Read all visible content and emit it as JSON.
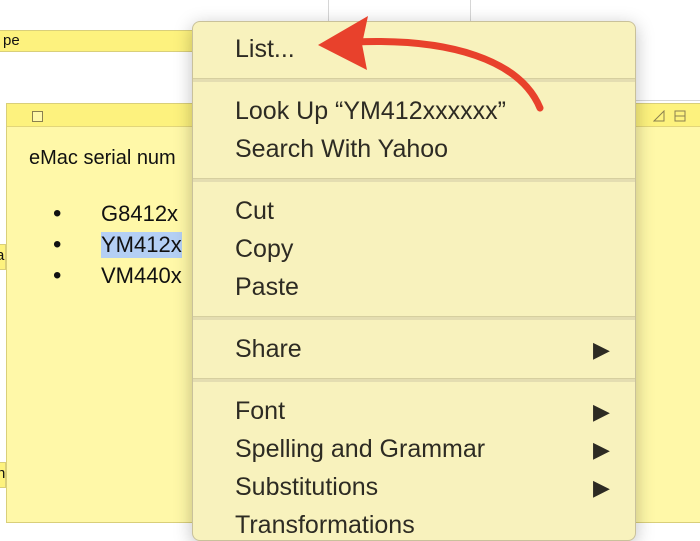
{
  "background_note": {
    "title_fragment": "pe"
  },
  "note": {
    "text": "eMac serial num",
    "items": [
      "G8412x",
      "YM412x",
      "VM440x"
    ],
    "left_fragment": "al",
    "left_fragment2": "n"
  },
  "context_menu": {
    "items": [
      {
        "label": "List..."
      },
      {
        "label": "Look Up “YM412xxxxxx”"
      },
      {
        "label": "Search With Yahoo"
      },
      {
        "label": "Cut"
      },
      {
        "label": "Copy"
      },
      {
        "label": "Paste"
      },
      {
        "label": "Share",
        "submenu_glyph": "▶"
      },
      {
        "label": "Font",
        "submenu_glyph": "▶"
      },
      {
        "label": "Spelling and Grammar",
        "submenu_glyph": "▶"
      },
      {
        "label": "Substitutions",
        "submenu_glyph": "▶"
      },
      {
        "label": "Transformations",
        "submenu_glyph": "▶"
      }
    ]
  },
  "annotation": {
    "arrow_color": "#e8412c",
    "icon": "curved-arrow-icon"
  }
}
